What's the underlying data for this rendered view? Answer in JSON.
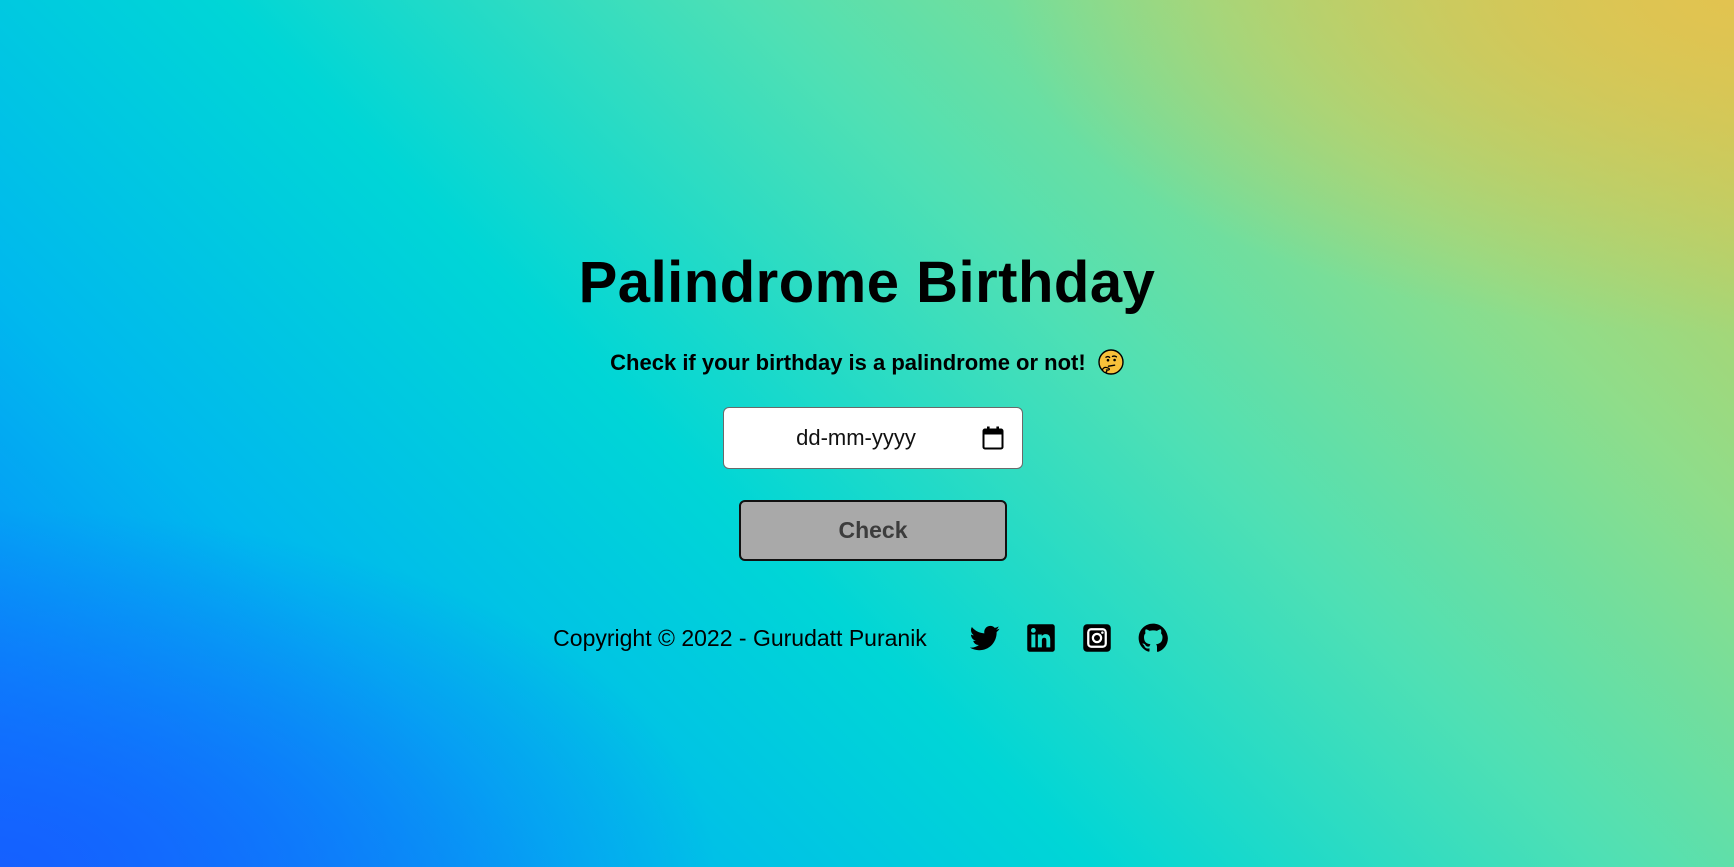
{
  "page": {
    "title": "Palindrome Birthday",
    "subtitle": "Check if your birthday is a palindrome or not!",
    "subtitle_emoji": "thinking-face-emoji"
  },
  "form": {
    "date_placeholder": "dd-mm-yyyy",
    "date_value": "",
    "date_icon": "calendar-icon",
    "check_label": "Check"
  },
  "footer": {
    "copyright": "Copyright © 2022 - Gurudatt Puranik",
    "social_links": [
      {
        "name": "twitter",
        "icon": "twitter-icon"
      },
      {
        "name": "linkedin",
        "icon": "linkedin-icon"
      },
      {
        "name": "instagram",
        "icon": "instagram-icon"
      },
      {
        "name": "github",
        "icon": "github-icon"
      }
    ]
  },
  "colors": {
    "gradient_start": "#1560ff",
    "gradient_mid": "#00d6d6",
    "gradient_end": "#e2c350",
    "button_bg": "#a9a9a9",
    "button_text": "#3c3c3c",
    "text": "#000000"
  }
}
